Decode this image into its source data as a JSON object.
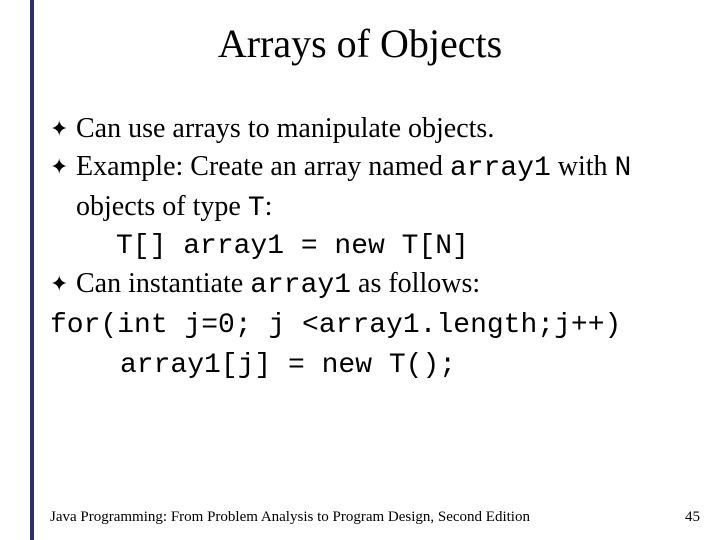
{
  "title": "Arrays of Objects",
  "bullets": {
    "b1": "Can use arrays to manipulate objects.",
    "b2": {
      "pre": "Example: Create an array named ",
      "code1": "array1",
      "mid": " with ",
      "code2": "N",
      "post_line": "objects of type ",
      "code3": "T",
      "colon": ":"
    },
    "code_line1": "T[] array1 = new T[N]",
    "b3": {
      "pre": "Can instantiate ",
      "code1": "array1",
      "post": " as follows:"
    },
    "code_line2": "for(int j=0; j <array1.length;j++)",
    "code_line3": "array1[j] = new T();"
  },
  "footer": {
    "text": "Java Programming: From Problem Analysis to Program Design, Second Edition",
    "page": "45"
  },
  "glyph": "✦"
}
